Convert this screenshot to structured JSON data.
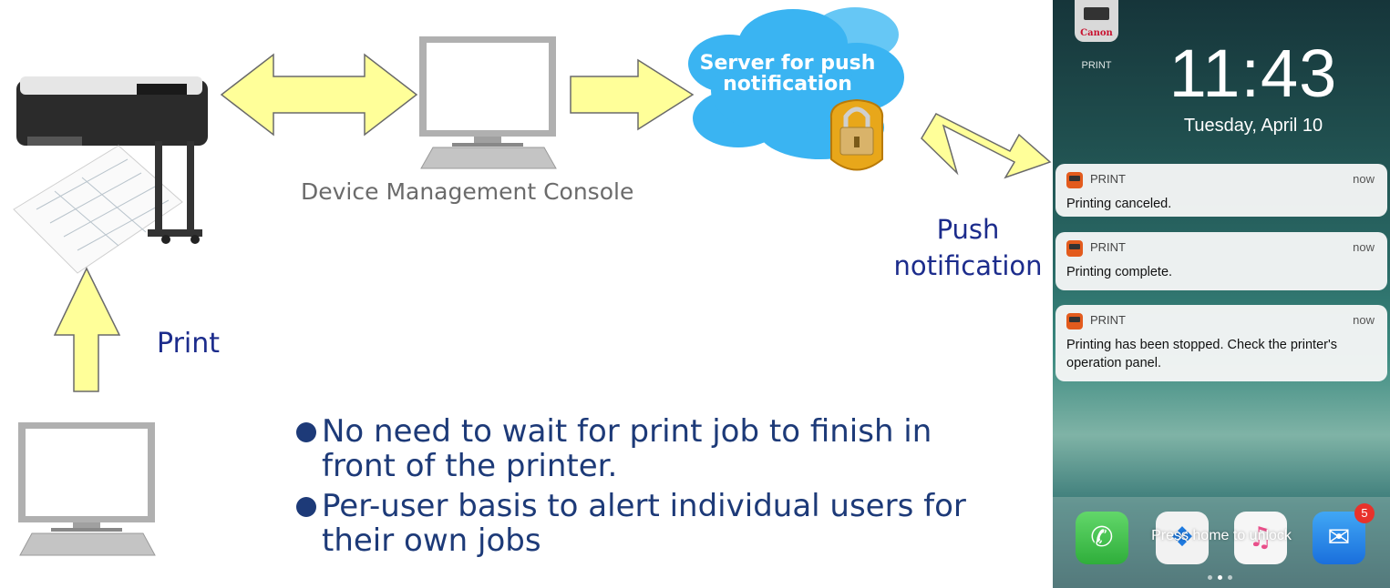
{
  "diagram": {
    "cloud_label": "Server for push notification",
    "console_label": "Device Management Console",
    "push_label": "Push notification",
    "print_label": "Print",
    "arrow_color": "#ffff99",
    "text_color": "#1c2c8c"
  },
  "bullets": [
    "No need to wait for print job to finish in front of the printer.",
    "Per-user basis to alert individual users for their own jobs"
  ],
  "phone": {
    "app_icon_brand": "Canon",
    "app_name": "PRINT",
    "time": "11:43",
    "date": "Tuesday, April 10",
    "notifications": [
      {
        "app": "PRINT",
        "time": "now",
        "message": "Printing canceled."
      },
      {
        "app": "PRINT",
        "time": "now",
        "message": "Printing complete."
      },
      {
        "app": "PRINT",
        "time": "now",
        "message": "Printing has been stopped. Check the printer's operation panel."
      }
    ],
    "unlock_hint": "Press home to unlock",
    "mail_badge": "5",
    "dock_icons": [
      "phone-icon",
      "safari-icon",
      "music-icon",
      "mail-icon"
    ]
  }
}
